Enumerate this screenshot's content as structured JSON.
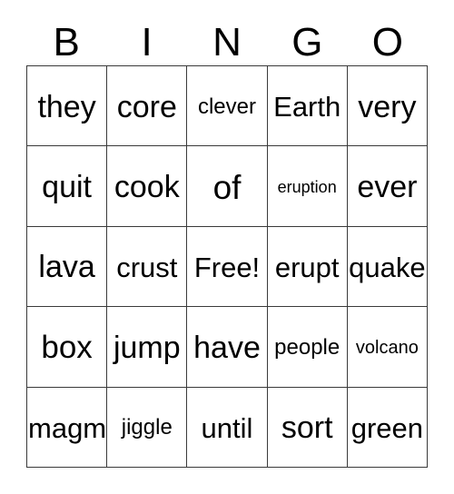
{
  "card": {
    "title": "BINGO",
    "header_letters": [
      "B",
      "I",
      "N",
      "G",
      "O"
    ],
    "grid_size": 5,
    "free_space_label": "Free!",
    "colors": {
      "background": "#ffffff",
      "text": "#000000",
      "grid_line": "#3a3a3a"
    },
    "rows": [
      {
        "cells": [
          {
            "label": "they"
          },
          {
            "label": "core"
          },
          {
            "label": "clever"
          },
          {
            "label": "Earth"
          },
          {
            "label": "very"
          }
        ]
      },
      {
        "cells": [
          {
            "label": "quit"
          },
          {
            "label": "cook"
          },
          {
            "label": "of"
          },
          {
            "label": "eruption"
          },
          {
            "label": "ever"
          }
        ]
      },
      {
        "cells": [
          {
            "label": "lava"
          },
          {
            "label": "crust"
          },
          {
            "label": "Free!"
          },
          {
            "label": "erupt"
          },
          {
            "label": "quake"
          }
        ]
      },
      {
        "cells": [
          {
            "label": "box"
          },
          {
            "label": "jump"
          },
          {
            "label": "have"
          },
          {
            "label": "people"
          },
          {
            "label": "volcano"
          }
        ]
      },
      {
        "cells": [
          {
            "label": "magma"
          },
          {
            "label": "jiggle"
          },
          {
            "label": "until"
          },
          {
            "label": "sort"
          },
          {
            "label": "green"
          }
        ]
      }
    ]
  }
}
